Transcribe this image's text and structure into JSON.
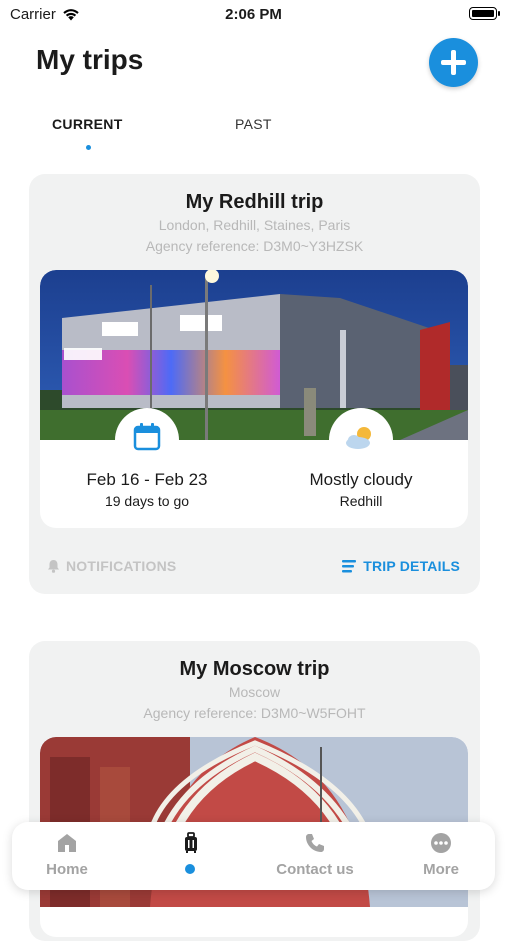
{
  "status_bar": {
    "carrier": "Carrier",
    "time": "2:06 PM"
  },
  "header": {
    "title": "My trips"
  },
  "tabs": [
    {
      "label": "CURRENT",
      "active": true
    },
    {
      "label": "PAST",
      "active": false
    }
  ],
  "trips": [
    {
      "title": "My Redhill trip",
      "destinations": "London, Redhill, Staines, Paris",
      "agency_reference": "Agency reference: D3M0~Y3HZSK",
      "dates": "Feb 16 - Feb 23",
      "countdown": "19 days to go",
      "weather": "Mostly cloudy",
      "weather_location": "Redhill",
      "notifications_label": "NOTIFICATIONS",
      "details_label": "TRIP DETAILS"
    },
    {
      "title": "My Moscow trip",
      "destinations": "Moscow",
      "agency_reference": "Agency reference: D3M0~W5FOHT"
    }
  ],
  "bottom_nav": {
    "items": [
      {
        "label": "Home",
        "icon": "home-icon"
      },
      {
        "label": "",
        "icon": "luggage-icon",
        "active": true
      },
      {
        "label": "Contact us",
        "icon": "phone-icon"
      },
      {
        "label": "More",
        "icon": "more-icon"
      }
    ]
  },
  "colors": {
    "accent": "#1a8fdd",
    "card_bg": "#f1f2f2",
    "muted": "#b8b8b8"
  }
}
